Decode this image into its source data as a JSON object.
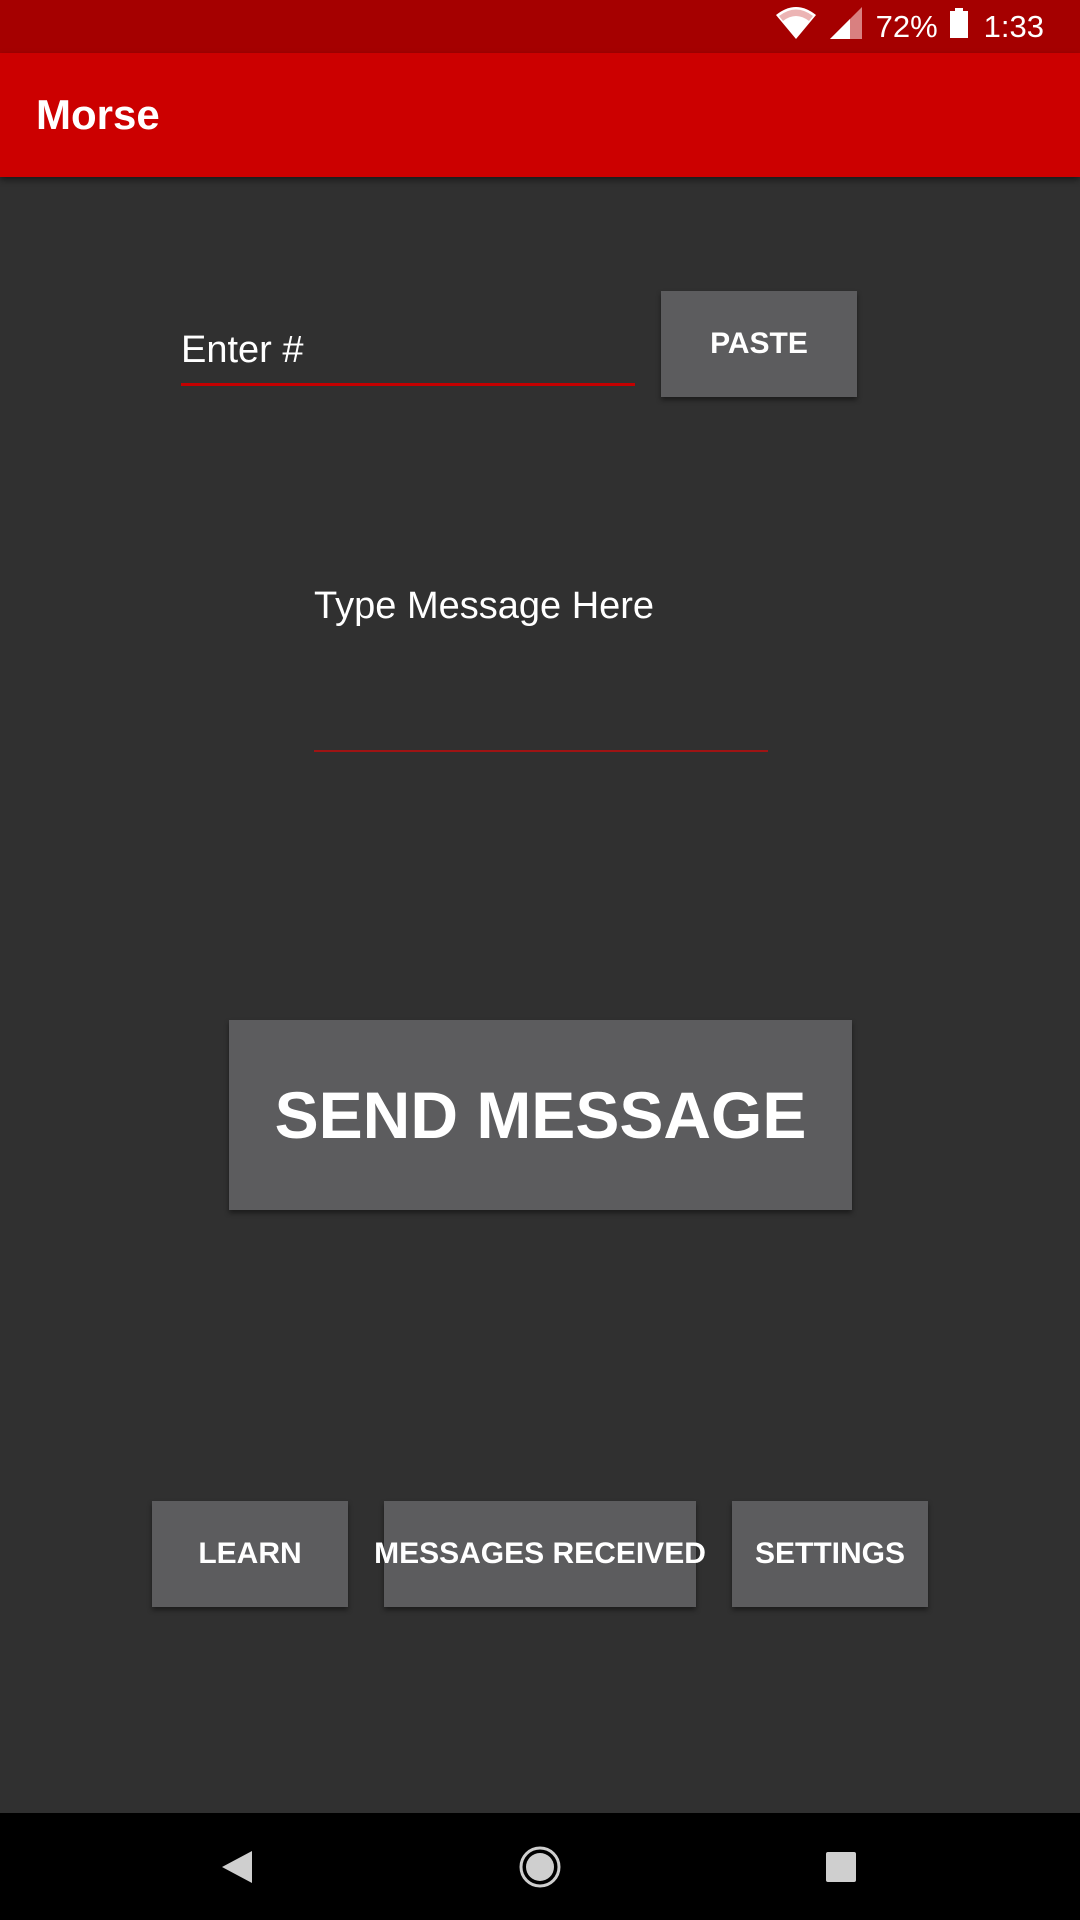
{
  "status_bar": {
    "battery_percent": "72%",
    "time": "1:33",
    "icons": [
      "wifi-icon",
      "signal-icon",
      "battery-icon"
    ]
  },
  "app_bar": {
    "title": "Morse"
  },
  "number_field": {
    "placeholder": "Enter #",
    "value": ""
  },
  "paste_button": {
    "label": "PASTE"
  },
  "message_field": {
    "placeholder": "Type Message Here",
    "value": ""
  },
  "send_button": {
    "label": "SEND MESSAGE"
  },
  "bottom_buttons": {
    "learn": "LEARN",
    "messages_received": "MESSAGES RECEIVED",
    "settings": "SETTINGS"
  },
  "nav_bar": {
    "icons": [
      "back-icon",
      "home-icon",
      "recents-icon"
    ]
  },
  "colors": {
    "status_bar": "#a50000",
    "app_bar": "#cc0000",
    "background": "#303030",
    "button": "#5c5c5e",
    "field_underline": "#c30000",
    "nav_bar": "#000000"
  }
}
